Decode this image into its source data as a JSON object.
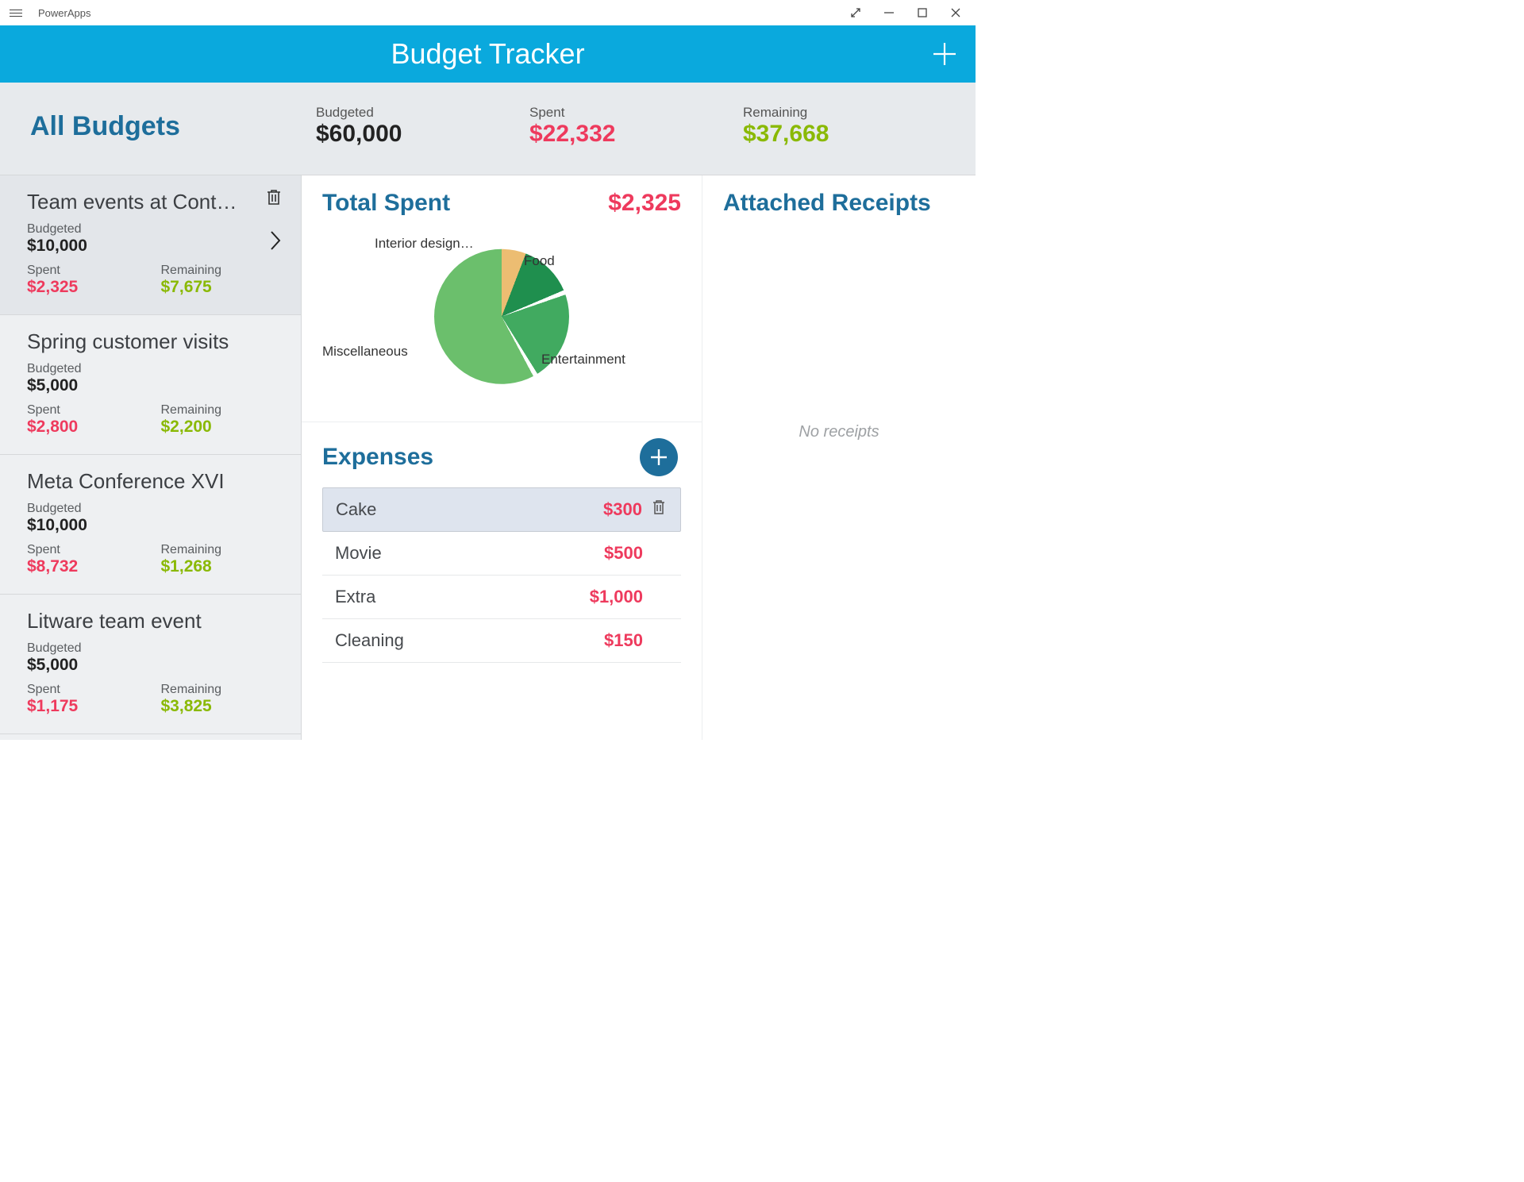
{
  "window": {
    "app_name": "PowerApps"
  },
  "header": {
    "title": "Budget Tracker"
  },
  "summary": {
    "title": "All Budgets",
    "budgeted_label": "Budgeted",
    "budgeted_value": "$60,000",
    "spent_label": "Spent",
    "spent_value": "$22,332",
    "remaining_label": "Remaining",
    "remaining_value": "$37,668"
  },
  "budgets": [
    {
      "title": "Team events at Cont…",
      "budgeted_label": "Budgeted",
      "budgeted": "$10,000",
      "spent_label": "Spent",
      "spent": "$2,325",
      "remaining_label": "Remaining",
      "remaining": "$7,675",
      "selected": true
    },
    {
      "title": "Spring customer visits",
      "budgeted_label": "Budgeted",
      "budgeted": "$5,000",
      "spent_label": "Spent",
      "spent": "$2,800",
      "remaining_label": "Remaining",
      "remaining": "$2,200",
      "selected": false
    },
    {
      "title": "Meta Conference XVI",
      "budgeted_label": "Budgeted",
      "budgeted": "$10,000",
      "spent_label": "Spent",
      "spent": "$8,732",
      "remaining_label": "Remaining",
      "remaining": "$1,268",
      "selected": false
    },
    {
      "title": "Litware team event",
      "budgeted_label": "Budgeted",
      "budgeted": "$5,000",
      "spent_label": "Spent",
      "spent": "$1,175",
      "remaining_label": "Remaining",
      "remaining": "$3,825",
      "selected": false
    }
  ],
  "detail": {
    "total_spent_label": "Total Spent",
    "total_spent_value": "$2,325",
    "pie_labels": {
      "interior": "Interior design…",
      "food": "Food",
      "misc": "Miscellaneous",
      "ent": "Entertainment"
    },
    "expenses_title": "Expenses",
    "expenses": [
      {
        "name": "Cake",
        "amount": "$300",
        "selected": true
      },
      {
        "name": "Movie",
        "amount": "$500",
        "selected": false
      },
      {
        "name": "Extra",
        "amount": "$1,000",
        "selected": false
      },
      {
        "name": "Cleaning",
        "amount": "$150",
        "selected": false
      }
    ]
  },
  "receipts": {
    "title": "Attached Receipts",
    "empty": "No receipts"
  },
  "chart_data": {
    "type": "pie",
    "title": "Total Spent",
    "categories": [
      "Interior design…",
      "Food",
      "Entertainment",
      "Miscellaneous"
    ],
    "values": [
      150,
      300,
      500,
      1375
    ],
    "total": 2325
  }
}
